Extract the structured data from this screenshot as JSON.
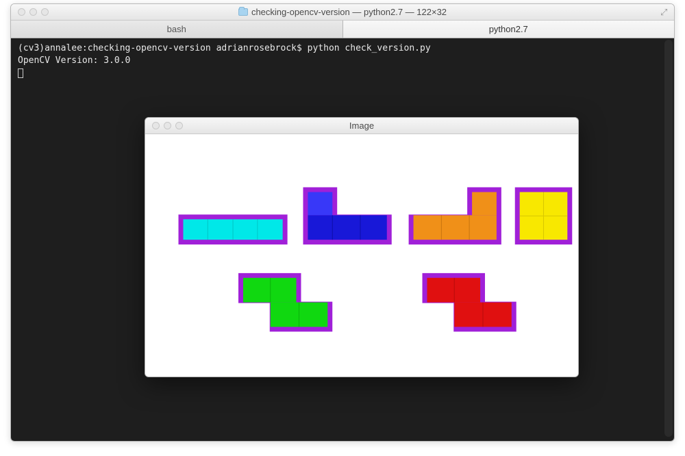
{
  "window": {
    "title": "checking-opencv-version — python2.7 — 122×32"
  },
  "tabs": [
    {
      "label": "bash",
      "active": false
    },
    {
      "label": "python2.7",
      "active": true
    }
  ],
  "terminal": {
    "prompt_line": "(cv3)annalee:checking-opencv-version adrianrosebrock$ python check_version.py",
    "output_line": "OpenCV Version: 3.0.0"
  },
  "image_window": {
    "title": "Image"
  },
  "shapes": {
    "outline": "#a020d8",
    "colors": {
      "cyan": "#00e8e8",
      "blue": "#1818d8",
      "blue_light": "#3838f8",
      "orange": "#f09018",
      "yellow": "#f8e800",
      "green": "#10d810",
      "red": "#e01010"
    }
  }
}
